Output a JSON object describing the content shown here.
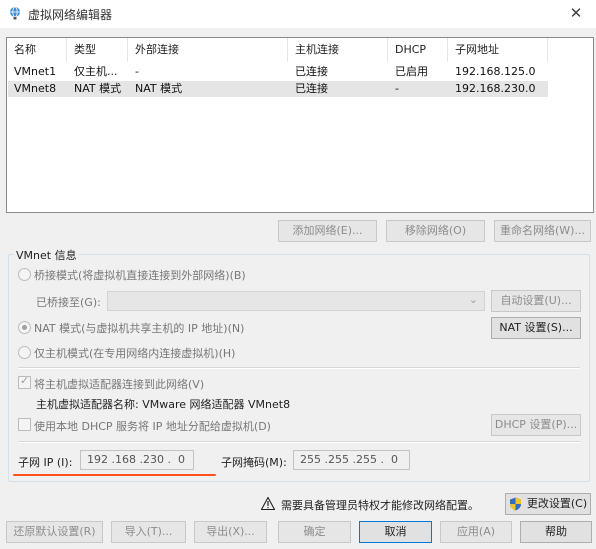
{
  "window": {
    "title": "虚拟网络编辑器",
    "close_glyph": "✕"
  },
  "table": {
    "columns": [
      "名称",
      "类型",
      "外部连接",
      "主机连接",
      "DHCP",
      "子网地址"
    ],
    "rows": [
      {
        "name": "VMnet1",
        "type": "仅主机...",
        "external": "-",
        "host": "已连接",
        "dhcp": "已启用",
        "subnet": "192.168.125.0",
        "selected": false
      },
      {
        "name": "VMnet8",
        "type": "NAT 模式",
        "external": "NAT 模式",
        "host": "已连接",
        "dhcp": "-",
        "subnet": "192.168.230.0",
        "selected": true
      }
    ]
  },
  "list_buttons": {
    "add": "添加网络(E)...",
    "remove": "移除网络(O)",
    "rename": "重命名网络(W)..."
  },
  "vmnet_info": {
    "group_title": "VMnet 信息",
    "bridged_label": "桥接模式(将虚拟机直接连接到外部网络)(B)",
    "bridged_to_label": "已桥接至(G):",
    "bridged_to_value": "",
    "auto_settings": "自动设置(U)...",
    "nat_label": "NAT 模式(与虚拟机共享主机的 IP 地址)(N)",
    "nat_settings": "NAT 设置(S)...",
    "host_only_label": "仅主机模式(在专用网络内连接虚拟机)(H)",
    "connect_adapter_label": "将主机虚拟适配器连接到此网络(V)",
    "adapter_name_label": "主机虚拟适配器名称: VMware 网络适配器 VMnet8",
    "use_dhcp_label": "使用本地 DHCP 服务将 IP 地址分配给虚拟机(D)",
    "dhcp_settings": "DHCP 设置(P)...",
    "subnet_ip_label": "子网 IP (I):",
    "subnet_ip_value": "192 .168 .230 .  0",
    "subnet_mask_label": "子网掩码(M):",
    "subnet_mask_value": "255 .255 .255 .  0"
  },
  "admin": {
    "notice": "需要具备管理员特权才能修改网络配置。",
    "change_settings": "更改设置(C)"
  },
  "footer": {
    "restore_defaults": "还原默认设置(R)",
    "import": "导入(T)...",
    "export": "导出(X)...",
    "ok": "确定",
    "cancel": "取消",
    "apply": "应用(A)",
    "help": "帮助"
  },
  "colors": {
    "accent_underline": "#ff4f1a",
    "focus_border": "#0078d7"
  },
  "icons": {
    "app": "vmware-network-icon",
    "warning": "warning-icon",
    "shield": "uac-shield-icon",
    "dropdown": "chevron-down-icon"
  }
}
